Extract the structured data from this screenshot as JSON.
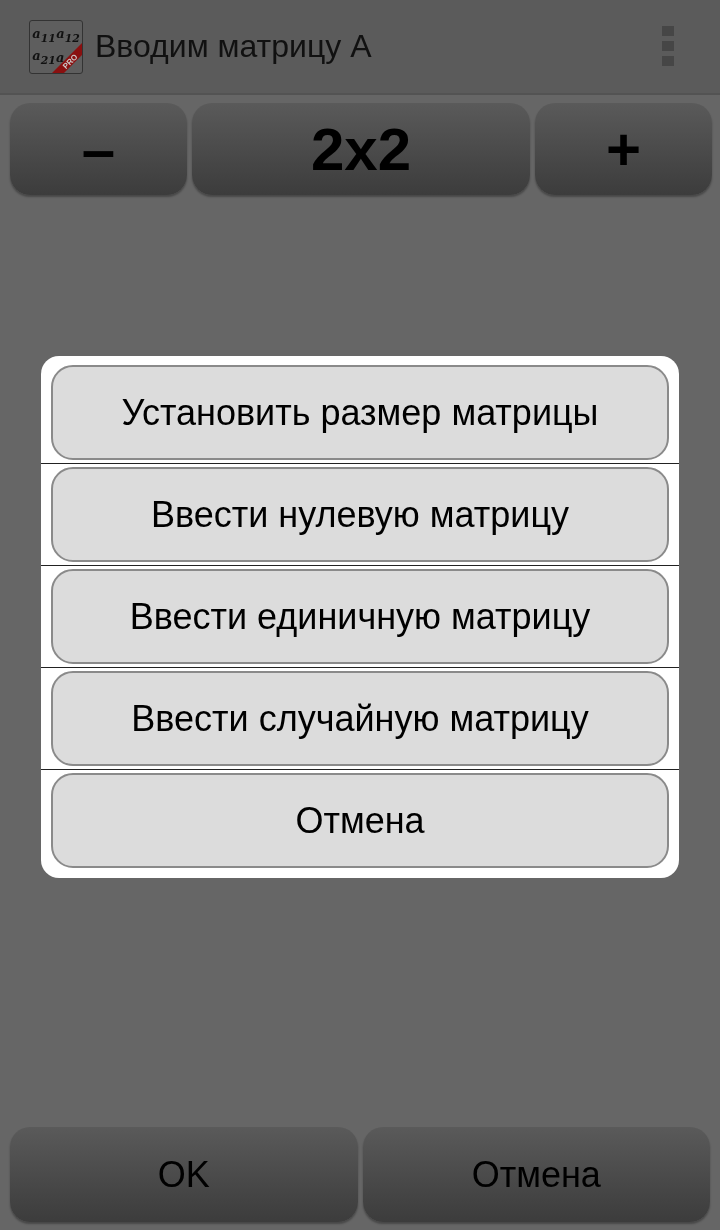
{
  "app_bar": {
    "icon": {
      "cells": [
        "a$_{11}$",
        "a$_{12}$",
        "a$_{21}$",
        "a"
      ],
      "badge": "PRO"
    },
    "title": "Вводим матрицу A"
  },
  "size_controls": {
    "decrease": "–",
    "size": "2x2",
    "increase": "+"
  },
  "dialog": {
    "items": [
      "Установить размер матрицы",
      "Ввести нулевую матрицу",
      "Ввести единичную матрицу",
      "Ввести случайную матрицу",
      "Отмена"
    ]
  },
  "buttons": [
    "OK",
    "Отмена"
  ]
}
